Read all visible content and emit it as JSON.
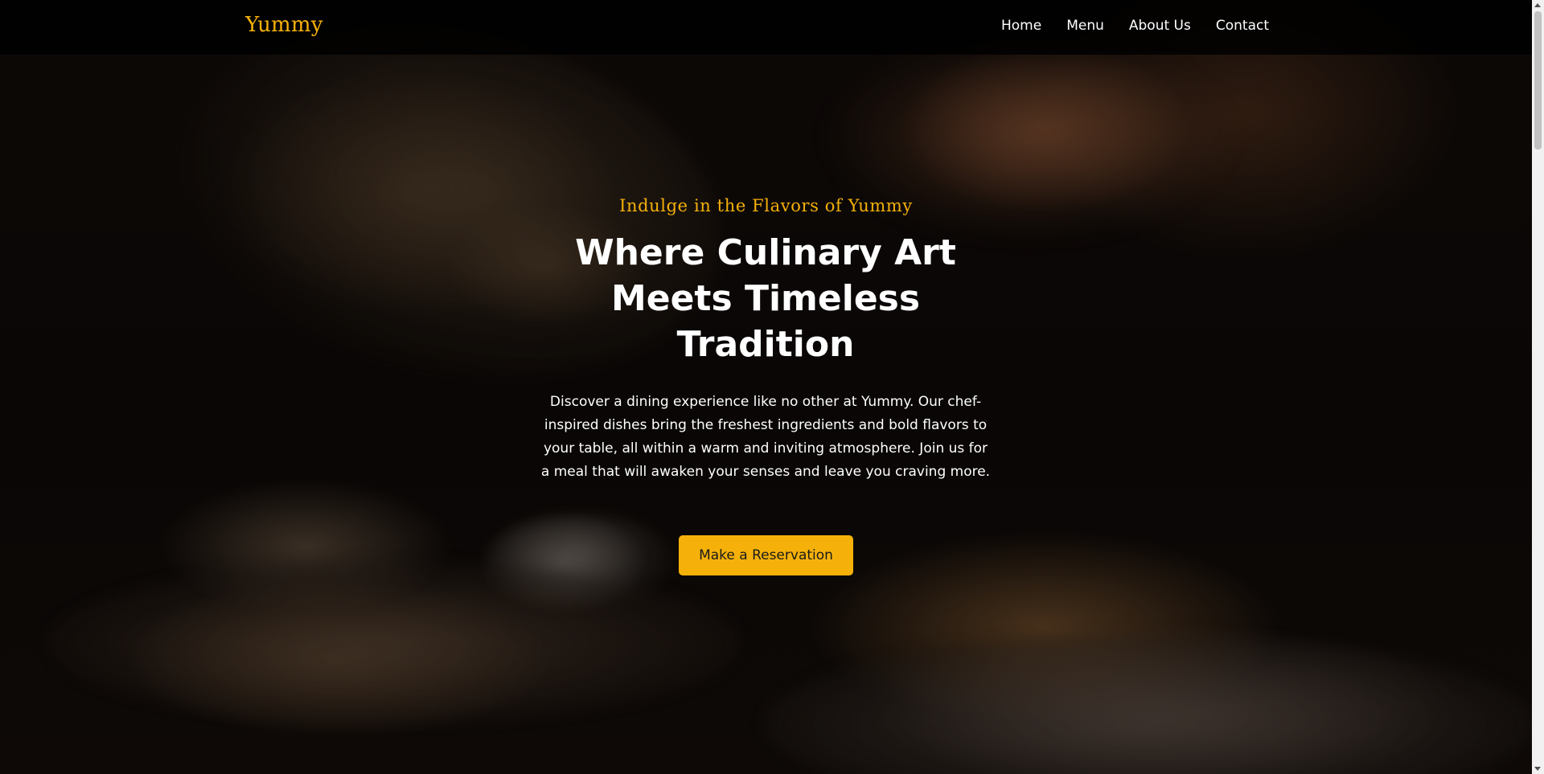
{
  "navbar": {
    "brand": "Yummy",
    "links": [
      {
        "label": "Home"
      },
      {
        "label": "Menu"
      },
      {
        "label": "About Us"
      },
      {
        "label": "Contact"
      }
    ]
  },
  "hero": {
    "tagline": "Indulge in the Flavors of Yummy",
    "headline": "Where Culinary Art Meets Timeless Tradition",
    "description": "Discover a dining experience like no other at Yummy. Our chef-inspired dishes bring the freshest ingredients and bold flavors to your table, all within a warm and inviting atmosphere. Join us for a meal that will awaken your senses and leave you craving more.",
    "cta_label": "Make a Reservation",
    "background_icon": "restaurant-food-photo"
  },
  "colors": {
    "accent": "#f5b10a",
    "navbar_bg": "#000000",
    "text": "#ffffff"
  }
}
